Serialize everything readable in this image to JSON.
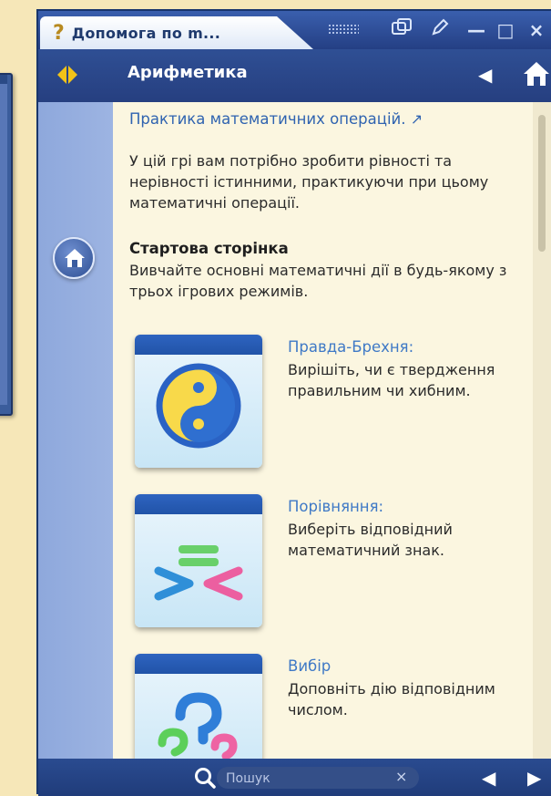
{
  "window": {
    "tab_title": "Допомога по m...",
    "tab_icon": "question-icon"
  },
  "titlebar_controls": [
    "dots-grip-icon",
    "window-mode-icon",
    "pencil-icon",
    "minimize-icon",
    "maximize-icon",
    "close-icon"
  ],
  "titlebar_glyphs": {
    "minimize": "—",
    "maximize": "□",
    "close": "×"
  },
  "navbar": {
    "title": "Арифметика",
    "toc_icon": "table-of-contents-icon",
    "back_glyph": "◀",
    "home_icon": "home-icon"
  },
  "content": {
    "heading": "Практика математичних операцій.",
    "intro": "У цій грі вам потрібно зробити рівності та нерівності істинними, практикуючи при цьому математичні операції.",
    "section_title": "Стартова сторінка",
    "section_text": "Вивчайте основні математичні дії в будь-якому з трьох ігрових режимів.",
    "modes": [
      {
        "name": "Правда-Брехня:",
        "desc": "Вирішіть, чи є твердження правильним чи хибним.",
        "icon": "yin-yang-icon"
      },
      {
        "name": "Порівняння:",
        "desc": "Виберіть відповідний математичний знак.",
        "icon": "compare-signs-icon"
      },
      {
        "name": "Вибір",
        "desc": "Доповніть дію відповідним числом.",
        "icon": "question-marks-icon"
      }
    ]
  },
  "bottombar": {
    "search_placeholder": "Пошук",
    "clear_glyph": "×",
    "back_glyph": "◀",
    "forward_glyph": "▶"
  },
  "colors": {
    "window_blue": "#264a8e",
    "sidebar": "#9db4e2",
    "content_bg": "#fbf6e0",
    "link": "#2f63b0",
    "mode_title": "#3f79c6",
    "page_bg": "#f6e7b8"
  }
}
